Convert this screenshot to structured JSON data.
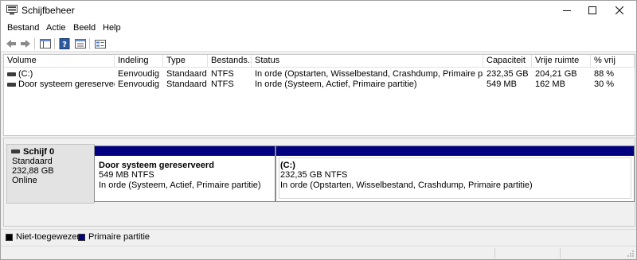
{
  "window": {
    "title": "Schijfbeheer",
    "controls": {
      "minimize": "—",
      "maximize": "☐",
      "close": "✕"
    }
  },
  "menu": [
    "Bestand",
    "Actie",
    "Beeld",
    "Help"
  ],
  "toolbar": {
    "icons": [
      "back-arrow-icon",
      "forward-arrow-icon",
      "console-tree-icon",
      "help-icon",
      "properties-icon",
      "disk-settings-icon"
    ]
  },
  "volume_list": {
    "columns": [
      "Volume",
      "Indeling",
      "Type",
      "Bestands...",
      "Status",
      "Capaciteit",
      "Vrije ruimte",
      "% vrij"
    ],
    "rows": [
      [
        "(C:)",
        "Eenvoudig",
        "Standaard",
        "NTFS",
        "In orde (Opstarten, Wisselbestand, Crashdump, Primaire partitie)",
        "232,35 GB",
        "204,21 GB",
        "88 %"
      ],
      [
        "Door systeem gereserveerd",
        "Eenvoudig",
        "Standaard",
        "NTFS",
        "In orde (Systeem, Actief, Primaire partitie)",
        "549 MB",
        "162 MB",
        "30 %"
      ]
    ]
  },
  "disk": {
    "name": "Schijf 0",
    "type": "Standaard",
    "size": "232,88 GB",
    "state": "Online",
    "partitions": [
      {
        "name": "Door systeem gereserveerd",
        "size": "549 MB NTFS",
        "status": "In orde (Systeem, Actief, Primaire partitie)"
      },
      {
        "name": "(C:)",
        "size": "232,35 GB NTFS",
        "status": "In orde (Opstarten, Wisselbestand, Crashdump, Primaire partitie)"
      }
    ]
  },
  "legend": [
    {
      "label": "Niet-toegewezen",
      "color": "#000000"
    },
    {
      "label": "Primaire partitie",
      "color": "#000080"
    }
  ],
  "colors": {
    "primary_partition": "#000080",
    "unallocated": "#000000"
  }
}
